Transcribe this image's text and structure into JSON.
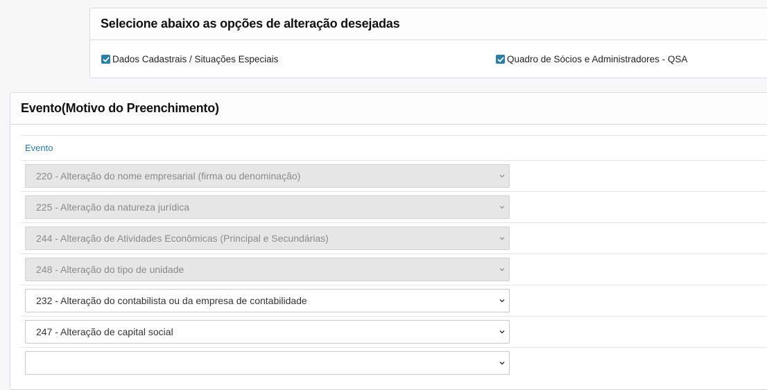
{
  "alteration_panel": {
    "title": "Selecione abaixo as opções de alteração desejadas",
    "options": [
      {
        "label": "Dados Cadastrais / Situações Especiais",
        "checked": true
      },
      {
        "label": "Quadro de Sócios e Administradores - QSA",
        "checked": true
      }
    ]
  },
  "event_panel": {
    "title": "Evento(Motivo do Preenchimento)",
    "column_header": "Evento",
    "selects": [
      {
        "value": "220 - Alteração do nome empresarial (firma ou denominação)",
        "disabled": true
      },
      {
        "value": "225 - Alteração da natureza jurídica",
        "disabled": true
      },
      {
        "value": "244 - Alteração de Atividades Econômicas (Principal e Secundárias)",
        "disabled": true
      },
      {
        "value": "248 - Alteração do tipo de unidade",
        "disabled": true
      },
      {
        "value": "232 - Alteração do contabilista ou da empresa de contabilidade",
        "disabled": false
      },
      {
        "value": "247 - Alteração de capital social",
        "disabled": false
      },
      {
        "value": "",
        "disabled": false
      }
    ]
  },
  "colors": {
    "accent": "#2a7fa8",
    "disabled_bg": "#e6e6e6",
    "border": "#d9d9e3"
  },
  "icons": {
    "checkbox": "check-icon",
    "select_arrow": "chevron-down-icon"
  }
}
